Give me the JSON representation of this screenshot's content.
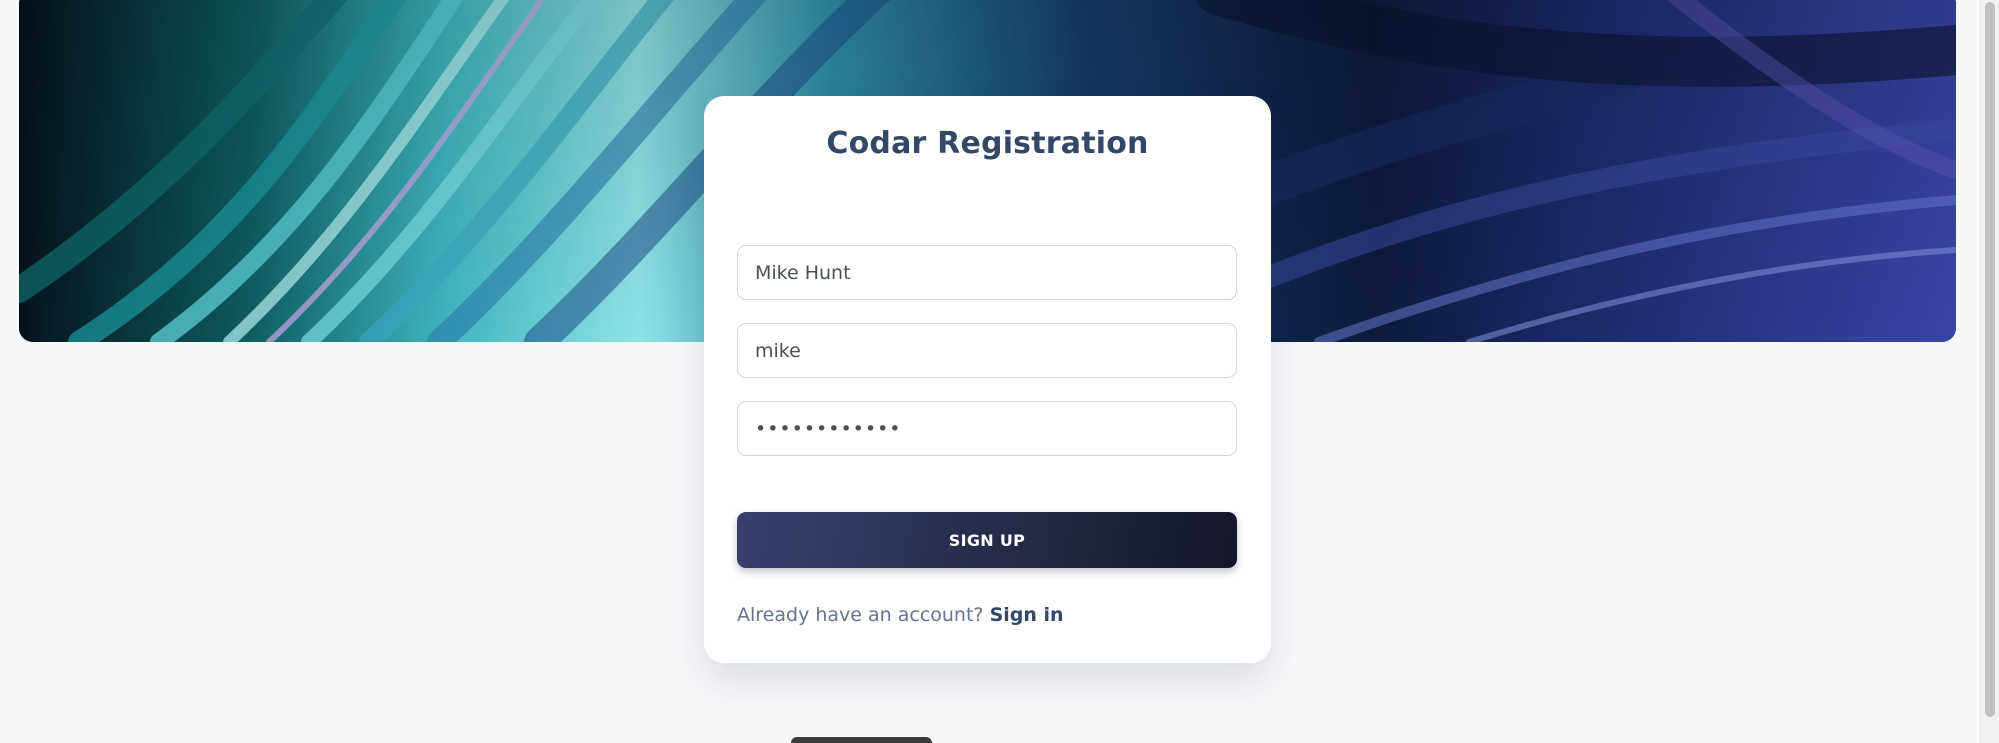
{
  "card": {
    "title": "Codar Registration",
    "name_value": "Mike Hunt",
    "username_value": "mike",
    "password_value": "••••••••••••",
    "signup_label": "SIGN UP",
    "have_account_text": "Already have an account?",
    "signin_label": "Sign in"
  },
  "colors": {
    "title": "#344767",
    "button_start": "#3a416f",
    "button_end": "#141727",
    "muted_text": "#67748e",
    "page_background": "#f7f8fa"
  }
}
